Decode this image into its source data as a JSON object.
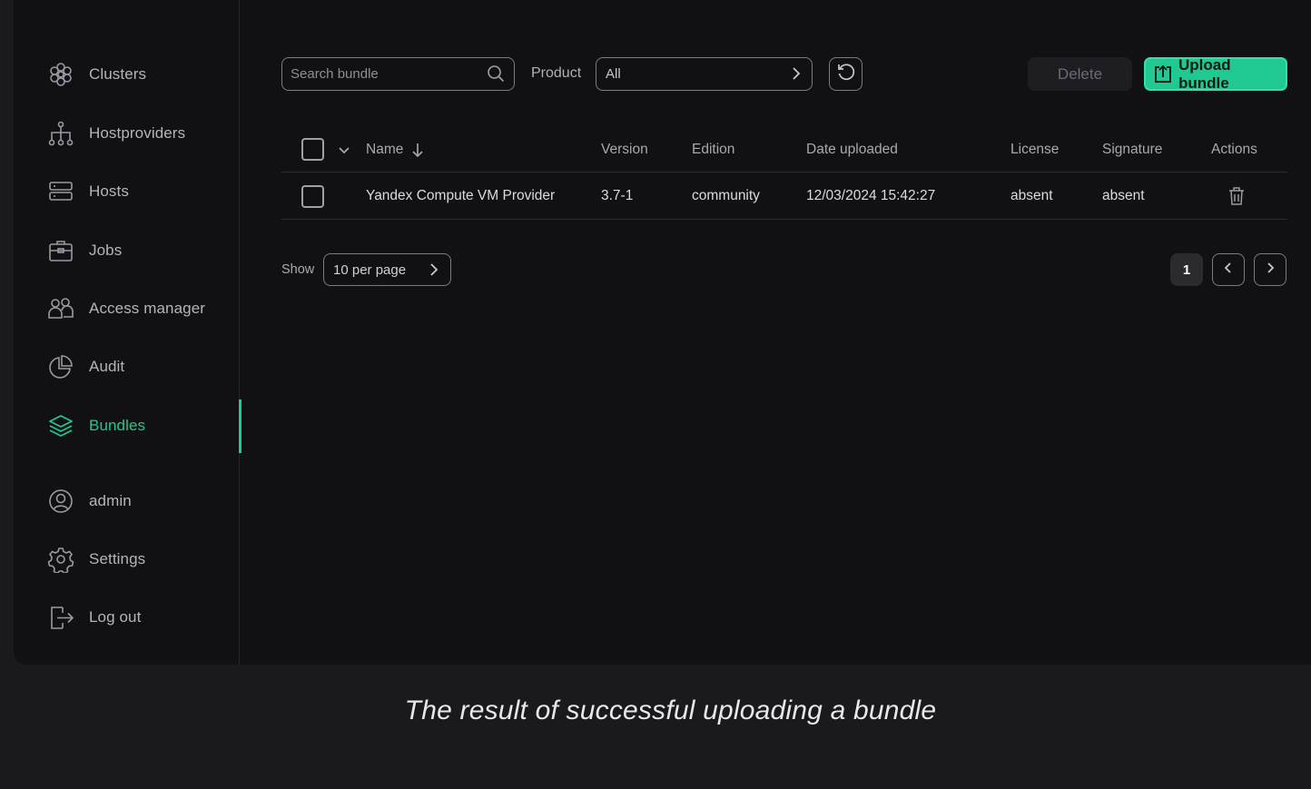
{
  "sidebar": {
    "items": [
      {
        "label": "Clusters",
        "icon": "clusters-icon"
      },
      {
        "label": "Hostproviders",
        "icon": "hostproviders-icon"
      },
      {
        "label": "Hosts",
        "icon": "hosts-icon"
      },
      {
        "label": "Jobs",
        "icon": "jobs-icon"
      },
      {
        "label": "Access manager",
        "icon": "access-manager-icon"
      },
      {
        "label": "Audit",
        "icon": "audit-icon"
      },
      {
        "label": "Bundles",
        "icon": "bundles-icon",
        "active": true
      }
    ],
    "bottom": [
      {
        "label": "admin",
        "icon": "user-icon"
      },
      {
        "label": "Settings",
        "icon": "gear-icon"
      },
      {
        "label": "Log out",
        "icon": "logout-icon"
      }
    ]
  },
  "toolbar": {
    "search_placeholder": "Search bundle",
    "product_label": "Product",
    "product_value": "All",
    "delete_label": "Delete",
    "upload_label": "Upload bundle"
  },
  "table": {
    "columns": [
      "Name",
      "Version",
      "Edition",
      "Date uploaded",
      "License",
      "Signature",
      "Actions"
    ],
    "rows": [
      {
        "name": "Yandex Compute VM Provider",
        "version": "3.7-1",
        "edition": "community",
        "date": "12/03/2024 15:42:27",
        "license": "absent",
        "signature": "absent"
      }
    ]
  },
  "pagination": {
    "show_label": "Show",
    "per_page": "10 per page",
    "current_page": "1"
  },
  "caption": "The result of successful uploading a bundle",
  "colors": {
    "accent": "#1fc991",
    "background": "#111114"
  }
}
